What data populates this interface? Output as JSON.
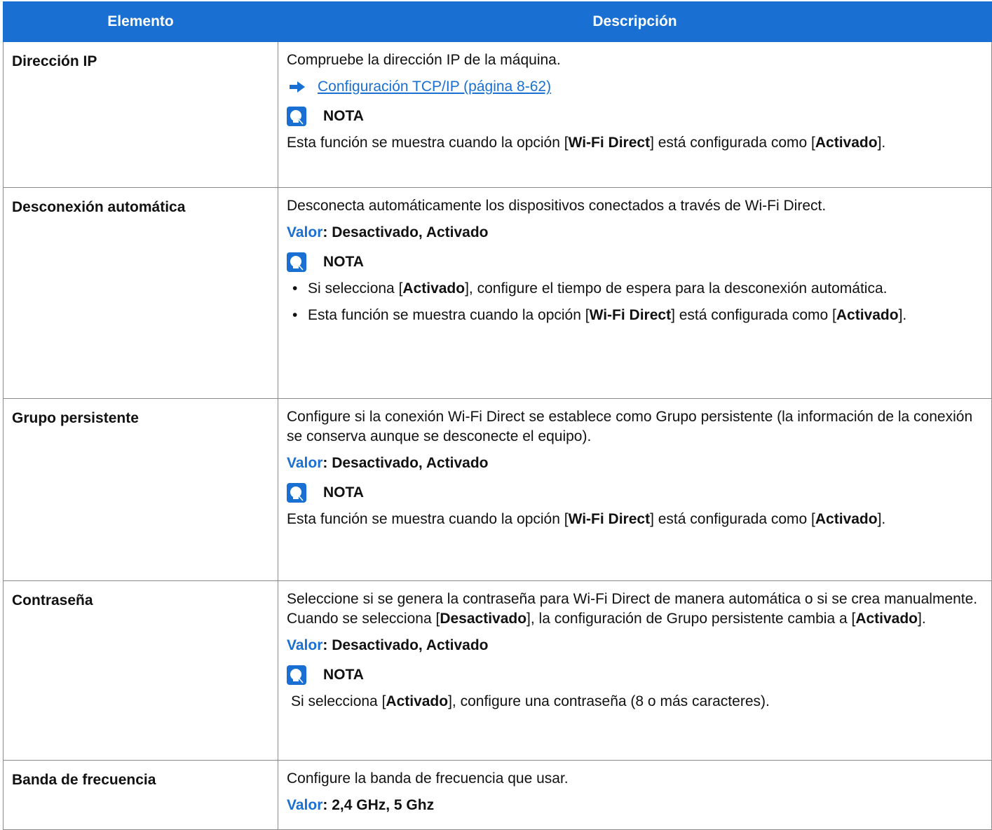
{
  "headers": {
    "item": "Elemento",
    "description": "Descripción"
  },
  "rows": [
    {
      "item": "Dirección IP",
      "text": "Compruebe la dirección IP de la máquina.",
      "link": "Configuración TCP/IP (página 8-62)",
      "note_title": "NOTA",
      "note": {
        "a": "Esta función se muestra cuando la opción [",
        "b": "Wi-Fi Direct",
        "c": "] está configurada como [",
        "d": "Activado",
        "e": "]."
      }
    },
    {
      "item": "Desconexión automática",
      "text": "Desconecta automáticamente los dispositivos conectados a través de Wi-Fi Direct.",
      "value_label": "Valor",
      "value": ": Desactivado, Activado",
      "note_title": "NOTA",
      "bullets": [
        {
          "a": "Si selecciona [",
          "b": "Activado",
          "c": "], configure el tiempo de espera para la desconexión automática."
        },
        {
          "a": "Esta función se muestra cuando la opción [",
          "b": "Wi-Fi Direct",
          "c": "] está configurada como [",
          "d": "Activado",
          "e": "]."
        }
      ]
    },
    {
      "item": "Grupo persistente",
      "text": "Configure si la conexión Wi-Fi Direct se establece como Grupo persistente (la información de la conexión se conserva aunque se desconecte el equipo).",
      "value_label": "Valor",
      "value": ": Desactivado, Activado",
      "note_title": "NOTA",
      "note": {
        "a": "Esta función se muestra cuando la opción [",
        "b": "Wi-Fi Direct",
        "c": "] está configurada como [",
        "d": "Activado",
        "e": "]."
      }
    },
    {
      "item": "Contraseña",
      "text": {
        "a": "Seleccione si se genera la contraseña para Wi-Fi Direct de manera automática o si se crea manualmente. Cuando se selecciona [",
        "b": "Desactivado",
        "c": "], la configuración de Grupo persistente cambia a [",
        "d": "Activado",
        "e": "]."
      },
      "value_label": "Valor",
      "value": ": Desactivado, Activado",
      "note_title": "NOTA",
      "note": {
        "a": "Si selecciona [",
        "b": "Activado",
        "c": "], configure una contraseña (8 o más caracteres)."
      }
    },
    {
      "item": "Banda de frecuencia",
      "text": "Configure la banda de frecuencia que usar.",
      "value_label": "Valor",
      "value": ": 2,4 GHz, 5 Ghz"
    }
  ]
}
